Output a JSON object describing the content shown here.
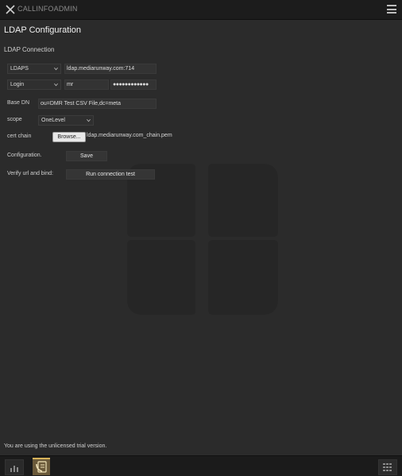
{
  "window": {
    "title": "CALLINFOADMIN"
  },
  "page": {
    "title": "LDAP Configuration",
    "section": "LDAP Connection"
  },
  "form": {
    "protocol": {
      "selected": "LDAPS"
    },
    "host": {
      "value": "ldap.mediarunway.com:714"
    },
    "auth": {
      "selected": "Login"
    },
    "username": {
      "value": "mr"
    },
    "password": {
      "masked": "●●●●●●●●●●●●"
    },
    "base_dn": {
      "label": "Base DN",
      "value": "ou=DMR Test CSV File,dc=meta"
    },
    "scope": {
      "label": "scope",
      "selected": "OneLevel"
    },
    "cert_chain": {
      "label": "cert chain",
      "browse_label": "Browse...",
      "file_name": "ldap.mediarunway.com_chain.pem"
    },
    "configuration": {
      "label": "Configuration.",
      "button": "Save"
    },
    "verify": {
      "label": "Verify url and bind:",
      "button": "Run connection test"
    }
  },
  "footer": {
    "trial_notice": "You are using the unlicensed trial version."
  },
  "icons": {
    "close": "close-icon",
    "menu": "hamburger-menu-icon",
    "chevron": "chevron-down-icon",
    "bg_logo": "windows-logo-icon",
    "taskbar_left": "chart-icon",
    "taskbar_active": "phone-book-icon",
    "taskbar_right": "grid-icon"
  },
  "colors": {
    "background": "#2b2b2b",
    "topbar": "#1c1c1c",
    "active_tab_accent": "#d7b35a"
  }
}
